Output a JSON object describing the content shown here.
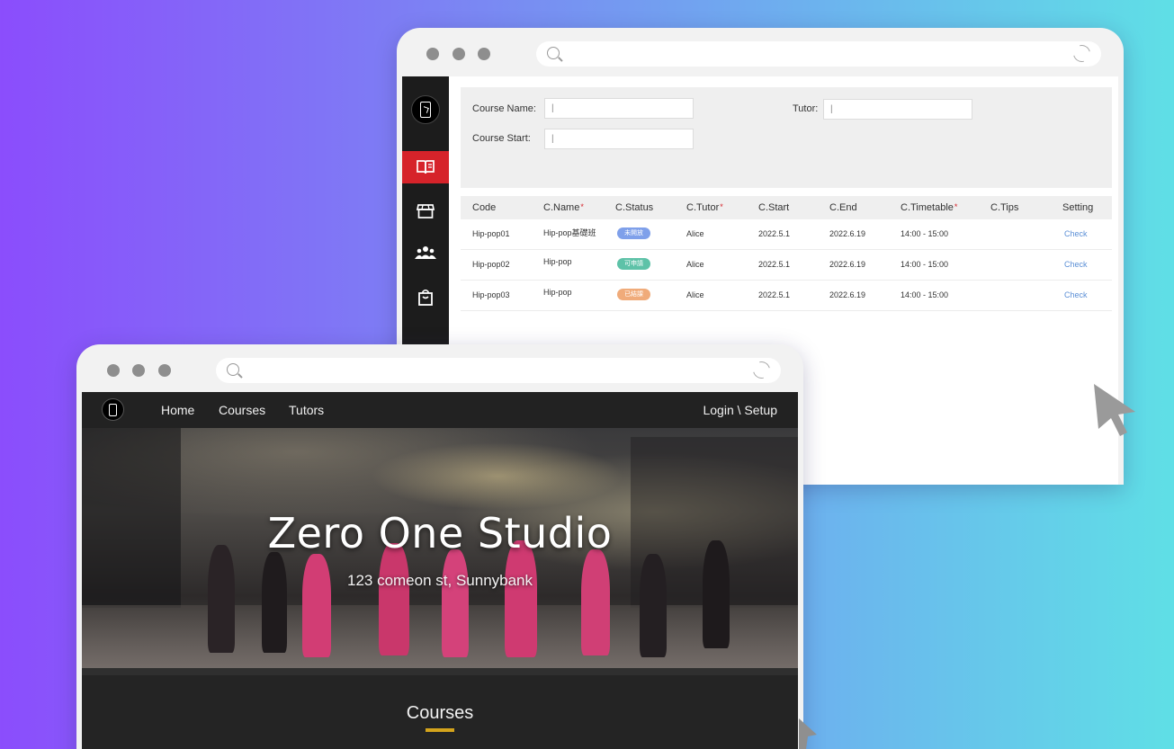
{
  "admin": {
    "filters": {
      "course_name_label": "Course Name:",
      "tutor_label": "Tutor:",
      "course_start_label": "Course Start:",
      "course_name_value": "|",
      "tutor_value": "|",
      "course_start_value": "|"
    },
    "sidebar_icons": [
      "book-icon",
      "store-icon",
      "users-icon",
      "bag-icon"
    ],
    "columns": [
      {
        "label": "Code",
        "required": false
      },
      {
        "label": "C.Name",
        "required": true
      },
      {
        "label": "C.Status",
        "required": false
      },
      {
        "label": "C.Tutor",
        "required": true
      },
      {
        "label": "C.Start",
        "required": false
      },
      {
        "label": "C.End",
        "required": false
      },
      {
        "label": "C.Timetable",
        "required": true
      },
      {
        "label": "C.Tips",
        "required": false
      },
      {
        "label": "Setting",
        "required": false
      }
    ],
    "required_mark": "*",
    "rows": [
      {
        "code": "Hip-pop01",
        "name": "Hip-pop基礎班",
        "status": "未開放",
        "status_color": "#7fa0ea",
        "tutor": "Alice",
        "start": "2022.5.1",
        "end": "2022.6.19",
        "timetable": "14:00 - 15:00",
        "tips": "",
        "setting": "Check"
      },
      {
        "code": "Hip-pop02",
        "name": "Hip-pop",
        "status": "可申請",
        "status_color": "#5ec2a8",
        "tutor": "Alice",
        "start": "2022.5.1",
        "end": "2022.6.19",
        "timetable": "14:00 - 15:00",
        "tips": "",
        "setting": "Check"
      },
      {
        "code": "Hip-pop03",
        "name": "Hip-pop",
        "status": "已結課",
        "status_color": "#f0ab7a",
        "tutor": "Alice",
        "start": "2022.5.1",
        "end": "2022.6.19",
        "timetable": "14:00 - 15:00",
        "tips": "",
        "setting": "Check"
      }
    ],
    "active_color": "#d6232a"
  },
  "site": {
    "nav": {
      "home": "Home",
      "courses": "Courses",
      "tutors": "Tutors",
      "login": "Login \\ Setup"
    },
    "hero": {
      "title": "Zero One Studio",
      "subtitle": "123 comeon st, Sunnybank"
    },
    "section_title": "Courses",
    "accent_color": "#d4a41c"
  }
}
